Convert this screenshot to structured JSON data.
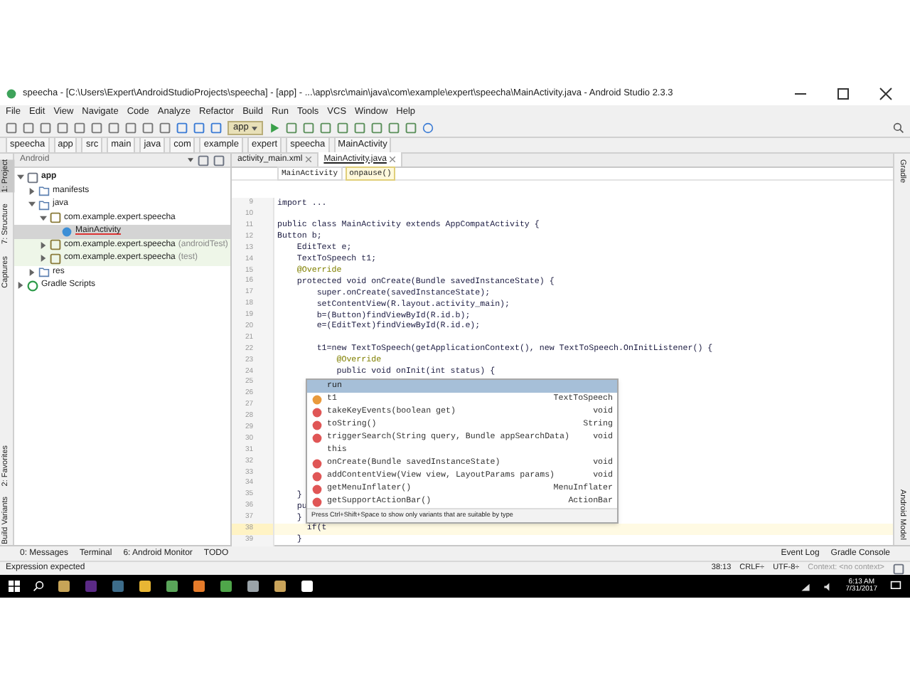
{
  "window": {
    "title": "speecha - [C:\\Users\\Expert\\AndroidStudioProjects\\speecha] - [app] - ...\\app\\src\\main\\java\\com\\example\\expert\\speecha\\MainActivity.java - Android Studio 2.3.3"
  },
  "menu": [
    "File",
    "Edit",
    "View",
    "Navigate",
    "Code",
    "Analyze",
    "Refactor",
    "Build",
    "Run",
    "Tools",
    "VCS",
    "Window",
    "Help"
  ],
  "toolbar": {
    "run_config": "app"
  },
  "nav_bar": [
    "speecha",
    "app",
    "src",
    "main",
    "java",
    "com",
    "example",
    "expert",
    "speecha",
    "MainActivity"
  ],
  "left_strip": [
    {
      "label": "1: Project",
      "selected": true
    },
    {
      "label": "7: Structure",
      "selected": false
    },
    {
      "label": "Captures",
      "selected": false
    },
    {
      "label": "2: Favorites",
      "selected": false
    },
    {
      "label": "Build Variants",
      "selected": false
    }
  ],
  "right_strip": [
    "Gradle",
    "Android Model"
  ],
  "project_panel": {
    "view": "Android",
    "tree": [
      {
        "label": "app",
        "kind": "module",
        "expanded": true,
        "selected": false,
        "children": [
          {
            "label": "manifests",
            "kind": "folder",
            "expanded": false,
            "selected": false
          },
          {
            "label": "java",
            "kind": "folder",
            "expanded": true,
            "selected": false,
            "children": [
              {
                "label": "com.example.expert.speecha",
                "kind": "package",
                "expanded": true,
                "selected": false,
                "children": [
                  {
                    "label": "MainActivity",
                    "kind": "class",
                    "selected": true
                  }
                ]
              },
              {
                "label": "com.example.expert.speecha",
                "suffix": "(androidTest)",
                "kind": "package",
                "expanded": false,
                "selected": false
              },
              {
                "label": "com.example.expert.speecha",
                "suffix": "(test)",
                "kind": "package",
                "expanded": false,
                "selected": false
              }
            ]
          },
          {
            "label": "res",
            "kind": "folder",
            "expanded": false,
            "selected": false
          }
        ]
      },
      {
        "label": "Gradle Scripts",
        "kind": "gradle",
        "expanded": false,
        "selected": false
      }
    ]
  },
  "editor": {
    "tabs": [
      {
        "label": "activity_main.xml",
        "selected": false
      },
      {
        "label": "MainActivity.java",
        "selected": true
      }
    ],
    "breadcrumbs": [
      {
        "label": "MainActivity",
        "selected": false
      },
      {
        "label": "onpause()",
        "selected": true
      }
    ],
    "lines": [
      {
        "number": "9",
        "text": "import ...",
        "kind": "code",
        "current": false
      },
      {
        "number": "10",
        "current": false
      },
      {
        "number": "11",
        "text": "public class MainActivity extends AppCompatActivity {",
        "kind": "code",
        "current": false
      },
      {
        "number": "12",
        "text": "Button b;",
        "kind": "code",
        "current": false
      },
      {
        "number": "13",
        "text": "    EditText e;",
        "kind": "code",
        "current": false
      },
      {
        "number": "14",
        "text": "    TextToSpeech t1;",
        "kind": "code",
        "current": false
      },
      {
        "number": "15",
        "text": "    @Override",
        "kind": "annotation",
        "current": false
      },
      {
        "number": "16",
        "text": "    protected void onCreate(Bundle savedInstanceState) {",
        "kind": "code",
        "current": false
      },
      {
        "number": "17",
        "text": "        super.onCreate(savedInstanceState);",
        "kind": "code",
        "current": false
      },
      {
        "number": "18",
        "text": "        setContentView(R.layout.activity_main);",
        "kind": "code",
        "current": false
      },
      {
        "number": "19",
        "text": "        b=(Button)findViewById(R.id.b);",
        "kind": "code",
        "current": false
      },
      {
        "number": "20",
        "text": "        e=(EditText)findViewById(R.id.e);",
        "kind": "code",
        "current": false
      },
      {
        "number": "21",
        "current": false
      },
      {
        "number": "22",
        "text": "        t1=new TextToSpeech(getApplicationContext(), new TextToSpeech.OnInitListener() {",
        "kind": "code",
        "current": false
      },
      {
        "number": "23",
        "text": "            @Override",
        "kind": "annotation",
        "current": false
      },
      {
        "number": "24",
        "text": "            public void onInit(int status) {",
        "kind": "code",
        "current": false
      },
      {
        "number": "25",
        "current": false
      },
      {
        "number": "26",
        "current": false
      },
      {
        "number": "27",
        "current": false
      },
      {
        "number": "28",
        "current": false
      },
      {
        "number": "29",
        "current": false
      },
      {
        "number": "30",
        "current": false
      },
      {
        "number": "31",
        "current": false
      },
      {
        "number": "32",
        "current": false
      },
      {
        "number": "33",
        "current": false
      },
      {
        "number": "34",
        "current": false
      },
      {
        "number": "35",
        "text": "    }",
        "kind": "code",
        "current": false
      },
      {
        "number": "36",
        "text": "    pu",
        "kind": "code",
        "current": false
      },
      {
        "number": "37",
        "text": "    }",
        "kind": "code",
        "current": false
      },
      {
        "number": "38",
        "text": "      if(t",
        "kind": "code",
        "current": true
      },
      {
        "number": "39",
        "text": "    }",
        "kind": "code",
        "current": false
      }
    ],
    "completion": {
      "items": [
        {
          "name": "run",
          "kind": "keyword",
          "selected": true
        },
        {
          "name": "t1",
          "type": "TextToSpeech",
          "kind": "field",
          "selected": false
        },
        {
          "name": "takeKeyEvents(boolean get)",
          "type": "void",
          "kind": "method",
          "selected": false
        },
        {
          "name": "toString()",
          "type": "String",
          "kind": "method",
          "selected": false
        },
        {
          "name": "triggerSearch(String query, Bundle appSearchData)",
          "type": "void",
          "kind": "method",
          "selected": false
        },
        {
          "name": "this",
          "kind": "keyword",
          "selected": false
        },
        {
          "name": "onCreate(Bundle savedInstanceState)",
          "type": "void",
          "kind": "method",
          "selected": false
        },
        {
          "name": "addContentView(View view, LayoutParams params)",
          "type": "void",
          "kind": "method",
          "selected": false
        },
        {
          "name": "getMenuInflater()",
          "type": "MenuInflater",
          "kind": "method",
          "selected": false
        },
        {
          "name": "getSupportActionBar()",
          "type": "ActionBar",
          "kind": "method",
          "selected": false
        }
      ],
      "hint": "Press Ctrl+Shift+Space to show only variants that are suitable by type"
    }
  },
  "tool_tabs": {
    "left": [
      "0: Messages",
      "Terminal",
      "6: Android Monitor",
      "TODO"
    ],
    "right": [
      "Event Log",
      "Gradle Console"
    ]
  },
  "status_bar": {
    "message": "Expression expected",
    "position": "38:13",
    "line_separator": "CRLF÷",
    "encoding": "UTF-8÷",
    "context": "Context: <no context>"
  },
  "taskbar": {
    "time": "6:13 AM",
    "date": "7/31/2017"
  }
}
